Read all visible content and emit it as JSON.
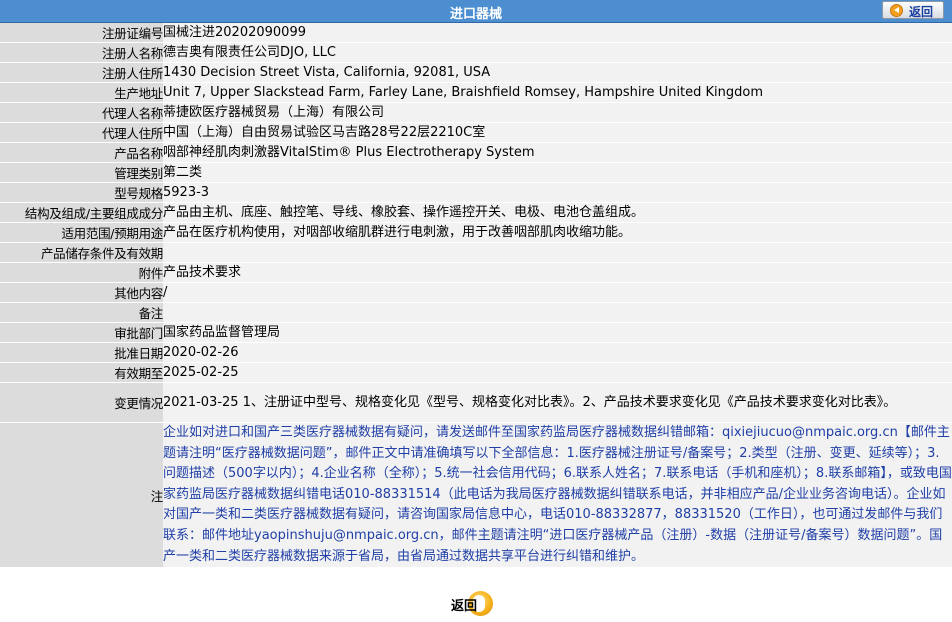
{
  "header": {
    "title": "进口器械",
    "back_label": "返回"
  },
  "fields": [
    {
      "label": "注册证编号",
      "value": "国械注进20202090099"
    },
    {
      "label": "注册人名称",
      "value": "德吉奥有限责任公司DJO, LLC"
    },
    {
      "label": "注册人住所",
      "value": "1430 Decision Street Vista, California, 92081, USA"
    },
    {
      "label": "生产地址",
      "value": "Unit 7, Upper Slackstead Farm, Farley Lane, Braishfield Romsey, Hampshire United Kingdom"
    },
    {
      "label": "代理人名称",
      "value": "蒂捷欧医疗器械贸易（上海）有限公司"
    },
    {
      "label": "代理人住所",
      "value": "中国（上海）自由贸易试验区马吉路28号22层2210C室"
    },
    {
      "label": "产品名称",
      "value": "咽部神经肌肉刺激器VitalStim® Plus Electrotherapy System"
    },
    {
      "label": "管理类别",
      "value": "第二类"
    },
    {
      "label": "型号规格",
      "value": "5923-3"
    },
    {
      "label": "结构及组成/主要组成成分",
      "value": "产品由主机、底座、触控笔、导线、橡胶套、操作遥控开关、电极、电池仓盖组成。"
    },
    {
      "label": "适用范围/预期用途",
      "value": "产品在医疗机构使用，对咽部收缩肌群进行电刺激，用于改善咽部肌肉收缩功能。"
    },
    {
      "label": "产品储存条件及有效期",
      "value": ""
    },
    {
      "label": "附件",
      "value": "产品技术要求"
    },
    {
      "label": "其他内容",
      "value": "/"
    },
    {
      "label": "备注",
      "value": ""
    },
    {
      "label": "审批部门",
      "value": "国家药品监督管理局"
    },
    {
      "label": "批准日期",
      "value": "2020-02-26"
    },
    {
      "label": "有效期至",
      "value": "2025-02-25"
    },
    {
      "label": "变更情况",
      "value": "2021-03-25 1、注册证中型号、规格变化见《型号、规格变化对比表》。2、产品技术要求变化见《产品技术要求变化对比表》。"
    },
    {
      "label": "注",
      "value": "企业如对进口和国产三类医疗器械数据有疑问，请发送邮件至国家药监局医疗器械数据纠错邮箱：qixiejiucuo@nmpaic.org.cn【邮件主题请注明“医疗器械数据问题”，邮件正文中请准确填写以下全部信息：1.医疗器械注册证号/备案号；2.类型（注册、变更、延续等）；3.问题描述（500字以内）；4.企业名称（全称）；5.统一社会信用代码；6.联系人姓名；7.联系电话（手机和座机）；8.联系邮箱】，或致电国家药监局医疗器械数据纠错电话010-88331514（此电话为我局医疗器械数据纠错联系电话，并非相应产品/企业业务咨询电话）。企业如对国产一类和二类医疗器械数据有疑问，请咨询国家局信息中心，电话010-88332877，88331520（工作日），也可通过发邮件与我们联系：邮件地址yaopinshuju@nmpaic.org.cn，邮件主题请注明“进口医疗器械产品（注册）-数据（注册证号/备案号）数据问题”。国产一类和二类医疗器械数据来源于省局，由省局通过数据共享平台进行纠错和维护。"
    }
  ],
  "footer": {
    "back_label": "返回"
  },
  "colors": {
    "header_bg": "#4c8ed0",
    "label_bg": "#dcdcdc",
    "value_bg": "#f2f2f2",
    "note_text": "#1f3fa6"
  }
}
